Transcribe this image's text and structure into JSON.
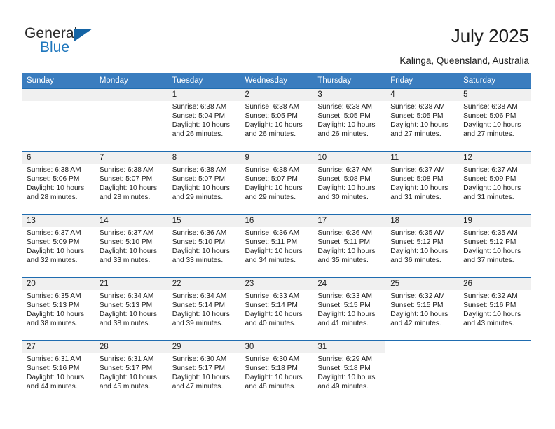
{
  "brand": {
    "name_top": "General",
    "name_bottom": "Blue",
    "accent_color": "#1464a5",
    "text_color": "#2b2b2b"
  },
  "header": {
    "title": "July 2025",
    "subtitle": "Kalinga, Queensland, Australia"
  },
  "calendar": {
    "header_background": "#3a7dbf",
    "row_border_color": "#1f6cb0",
    "daynum_band_color": "#f0f0f0",
    "weekdays": [
      "Sunday",
      "Monday",
      "Tuesday",
      "Wednesday",
      "Thursday",
      "Friday",
      "Saturday"
    ],
    "weeks": [
      [
        {
          "day": "",
          "empty": true
        },
        {
          "day": "",
          "empty": true
        },
        {
          "day": "1",
          "sunrise": "Sunrise: 6:38 AM",
          "sunset": "Sunset: 5:04 PM",
          "daylight_line1": "Daylight: 10 hours",
          "daylight_line2": "and 26 minutes."
        },
        {
          "day": "2",
          "sunrise": "Sunrise: 6:38 AM",
          "sunset": "Sunset: 5:05 PM",
          "daylight_line1": "Daylight: 10 hours",
          "daylight_line2": "and 26 minutes."
        },
        {
          "day": "3",
          "sunrise": "Sunrise: 6:38 AM",
          "sunset": "Sunset: 5:05 PM",
          "daylight_line1": "Daylight: 10 hours",
          "daylight_line2": "and 26 minutes."
        },
        {
          "day": "4",
          "sunrise": "Sunrise: 6:38 AM",
          "sunset": "Sunset: 5:05 PM",
          "daylight_line1": "Daylight: 10 hours",
          "daylight_line2": "and 27 minutes."
        },
        {
          "day": "5",
          "sunrise": "Sunrise: 6:38 AM",
          "sunset": "Sunset: 5:06 PM",
          "daylight_line1": "Daylight: 10 hours",
          "daylight_line2": "and 27 minutes."
        }
      ],
      [
        {
          "day": "6",
          "sunrise": "Sunrise: 6:38 AM",
          "sunset": "Sunset: 5:06 PM",
          "daylight_line1": "Daylight: 10 hours",
          "daylight_line2": "and 28 minutes."
        },
        {
          "day": "7",
          "sunrise": "Sunrise: 6:38 AM",
          "sunset": "Sunset: 5:07 PM",
          "daylight_line1": "Daylight: 10 hours",
          "daylight_line2": "and 28 minutes."
        },
        {
          "day": "8",
          "sunrise": "Sunrise: 6:38 AM",
          "sunset": "Sunset: 5:07 PM",
          "daylight_line1": "Daylight: 10 hours",
          "daylight_line2": "and 29 minutes."
        },
        {
          "day": "9",
          "sunrise": "Sunrise: 6:38 AM",
          "sunset": "Sunset: 5:07 PM",
          "daylight_line1": "Daylight: 10 hours",
          "daylight_line2": "and 29 minutes."
        },
        {
          "day": "10",
          "sunrise": "Sunrise: 6:37 AM",
          "sunset": "Sunset: 5:08 PM",
          "daylight_line1": "Daylight: 10 hours",
          "daylight_line2": "and 30 minutes."
        },
        {
          "day": "11",
          "sunrise": "Sunrise: 6:37 AM",
          "sunset": "Sunset: 5:08 PM",
          "daylight_line1": "Daylight: 10 hours",
          "daylight_line2": "and 31 minutes."
        },
        {
          "day": "12",
          "sunrise": "Sunrise: 6:37 AM",
          "sunset": "Sunset: 5:09 PM",
          "daylight_line1": "Daylight: 10 hours",
          "daylight_line2": "and 31 minutes."
        }
      ],
      [
        {
          "day": "13",
          "sunrise": "Sunrise: 6:37 AM",
          "sunset": "Sunset: 5:09 PM",
          "daylight_line1": "Daylight: 10 hours",
          "daylight_line2": "and 32 minutes."
        },
        {
          "day": "14",
          "sunrise": "Sunrise: 6:37 AM",
          "sunset": "Sunset: 5:10 PM",
          "daylight_line1": "Daylight: 10 hours",
          "daylight_line2": "and 33 minutes."
        },
        {
          "day": "15",
          "sunrise": "Sunrise: 6:36 AM",
          "sunset": "Sunset: 5:10 PM",
          "daylight_line1": "Daylight: 10 hours",
          "daylight_line2": "and 33 minutes."
        },
        {
          "day": "16",
          "sunrise": "Sunrise: 6:36 AM",
          "sunset": "Sunset: 5:11 PM",
          "daylight_line1": "Daylight: 10 hours",
          "daylight_line2": "and 34 minutes."
        },
        {
          "day": "17",
          "sunrise": "Sunrise: 6:36 AM",
          "sunset": "Sunset: 5:11 PM",
          "daylight_line1": "Daylight: 10 hours",
          "daylight_line2": "and 35 minutes."
        },
        {
          "day": "18",
          "sunrise": "Sunrise: 6:35 AM",
          "sunset": "Sunset: 5:12 PM",
          "daylight_line1": "Daylight: 10 hours",
          "daylight_line2": "and 36 minutes."
        },
        {
          "day": "19",
          "sunrise": "Sunrise: 6:35 AM",
          "sunset": "Sunset: 5:12 PM",
          "daylight_line1": "Daylight: 10 hours",
          "daylight_line2": "and 37 minutes."
        }
      ],
      [
        {
          "day": "20",
          "sunrise": "Sunrise: 6:35 AM",
          "sunset": "Sunset: 5:13 PM",
          "daylight_line1": "Daylight: 10 hours",
          "daylight_line2": "and 38 minutes."
        },
        {
          "day": "21",
          "sunrise": "Sunrise: 6:34 AM",
          "sunset": "Sunset: 5:13 PM",
          "daylight_line1": "Daylight: 10 hours",
          "daylight_line2": "and 38 minutes."
        },
        {
          "day": "22",
          "sunrise": "Sunrise: 6:34 AM",
          "sunset": "Sunset: 5:14 PM",
          "daylight_line1": "Daylight: 10 hours",
          "daylight_line2": "and 39 minutes."
        },
        {
          "day": "23",
          "sunrise": "Sunrise: 6:33 AM",
          "sunset": "Sunset: 5:14 PM",
          "daylight_line1": "Daylight: 10 hours",
          "daylight_line2": "and 40 minutes."
        },
        {
          "day": "24",
          "sunrise": "Sunrise: 6:33 AM",
          "sunset": "Sunset: 5:15 PM",
          "daylight_line1": "Daylight: 10 hours",
          "daylight_line2": "and 41 minutes."
        },
        {
          "day": "25",
          "sunrise": "Sunrise: 6:32 AM",
          "sunset": "Sunset: 5:15 PM",
          "daylight_line1": "Daylight: 10 hours",
          "daylight_line2": "and 42 minutes."
        },
        {
          "day": "26",
          "sunrise": "Sunrise: 6:32 AM",
          "sunset": "Sunset: 5:16 PM",
          "daylight_line1": "Daylight: 10 hours",
          "daylight_line2": "and 43 minutes."
        }
      ],
      [
        {
          "day": "27",
          "sunrise": "Sunrise: 6:31 AM",
          "sunset": "Sunset: 5:16 PM",
          "daylight_line1": "Daylight: 10 hours",
          "daylight_line2": "and 44 minutes."
        },
        {
          "day": "28",
          "sunrise": "Sunrise: 6:31 AM",
          "sunset": "Sunset: 5:17 PM",
          "daylight_line1": "Daylight: 10 hours",
          "daylight_line2": "and 45 minutes."
        },
        {
          "day": "29",
          "sunrise": "Sunrise: 6:30 AM",
          "sunset": "Sunset: 5:17 PM",
          "daylight_line1": "Daylight: 10 hours",
          "daylight_line2": "and 47 minutes."
        },
        {
          "day": "30",
          "sunrise": "Sunrise: 6:30 AM",
          "sunset": "Sunset: 5:18 PM",
          "daylight_line1": "Daylight: 10 hours",
          "daylight_line2": "and 48 minutes."
        },
        {
          "day": "31",
          "sunrise": "Sunrise: 6:29 AM",
          "sunset": "Sunset: 5:18 PM",
          "daylight_line1": "Daylight: 10 hours",
          "daylight_line2": "and 49 minutes."
        },
        {
          "day": "",
          "empty": true,
          "blank": true
        },
        {
          "day": "",
          "empty": true,
          "blank": true
        }
      ]
    ]
  }
}
